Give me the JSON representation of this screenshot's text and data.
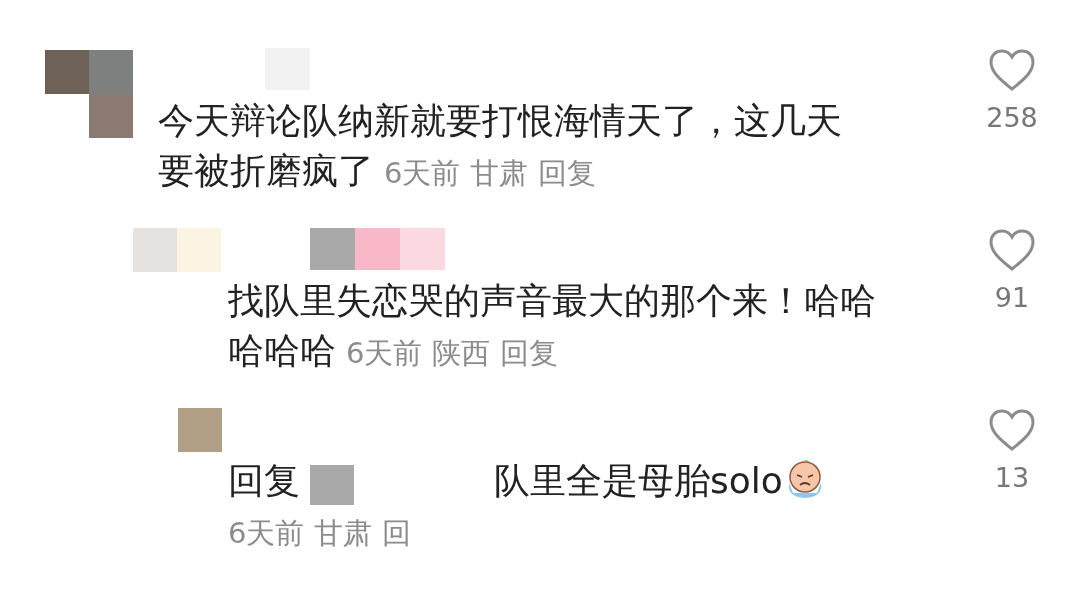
{
  "comments": [
    {
      "text": "今天辩论队纳新就要打恨海情天了，这几天要被折磨疯了",
      "time": "6天前",
      "location": "甘肃",
      "reply_action": "回复",
      "likes": "258",
      "liked": false,
      "children": [
        {
          "text": "找队里失恋哭的声音最大的那个来！哈哈哈哈哈",
          "time": "6天前",
          "location": "陕西",
          "reply_action": "回复",
          "likes": "91",
          "liked": false
        },
        {
          "reply_prefix": "回复",
          "text": "队里全是母胎solo",
          "time": "6天前",
          "location": "甘肃",
          "reply_action": "回",
          "likes": "13",
          "liked": false
        }
      ]
    }
  ]
}
